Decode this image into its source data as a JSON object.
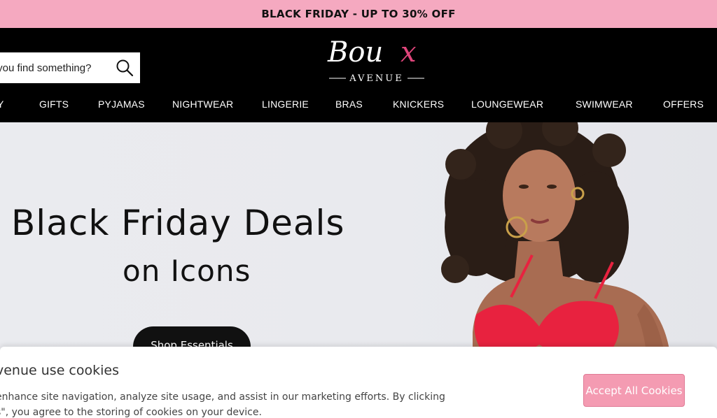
{
  "promo": {
    "text": "BLACK FRIDAY - UP TO 30% OFF",
    "bg_color": "#f5a9c0"
  },
  "header": {
    "bg_color": "#000000",
    "search": {
      "placeholder": "elp you find something?",
      "icon": "search-icon"
    },
    "logo": {
      "brand": "Boux",
      "accent_letter": "x",
      "sub": "AVENUE",
      "accent_color": "#e0457b"
    },
    "nav": [
      {
        "label": "Y"
      },
      {
        "label": "GIFTS"
      },
      {
        "label": "PYJAMAS"
      },
      {
        "label": "NIGHTWEAR"
      },
      {
        "label": "LINGERIE"
      },
      {
        "label": "BRAS"
      },
      {
        "label": "KNICKERS"
      },
      {
        "label": "LOUNGEWEAR"
      },
      {
        "label": "SWIMWEAR"
      },
      {
        "label": "OFFERS"
      }
    ]
  },
  "hero": {
    "title": "Black Friday Deals",
    "subtitle": "on Icons",
    "cta_label": "Shop Essentials"
  },
  "cookies": {
    "title": "venue use cookies",
    "text_line1": "enhance site navigation, analyze site usage, and assist in our marketing efforts. By clicking",
    "text_line2": "s\", you agree to the storing of cookies on your device.",
    "accept_label": "Accept All Cookies",
    "accept_color": "#f49bb2"
  }
}
